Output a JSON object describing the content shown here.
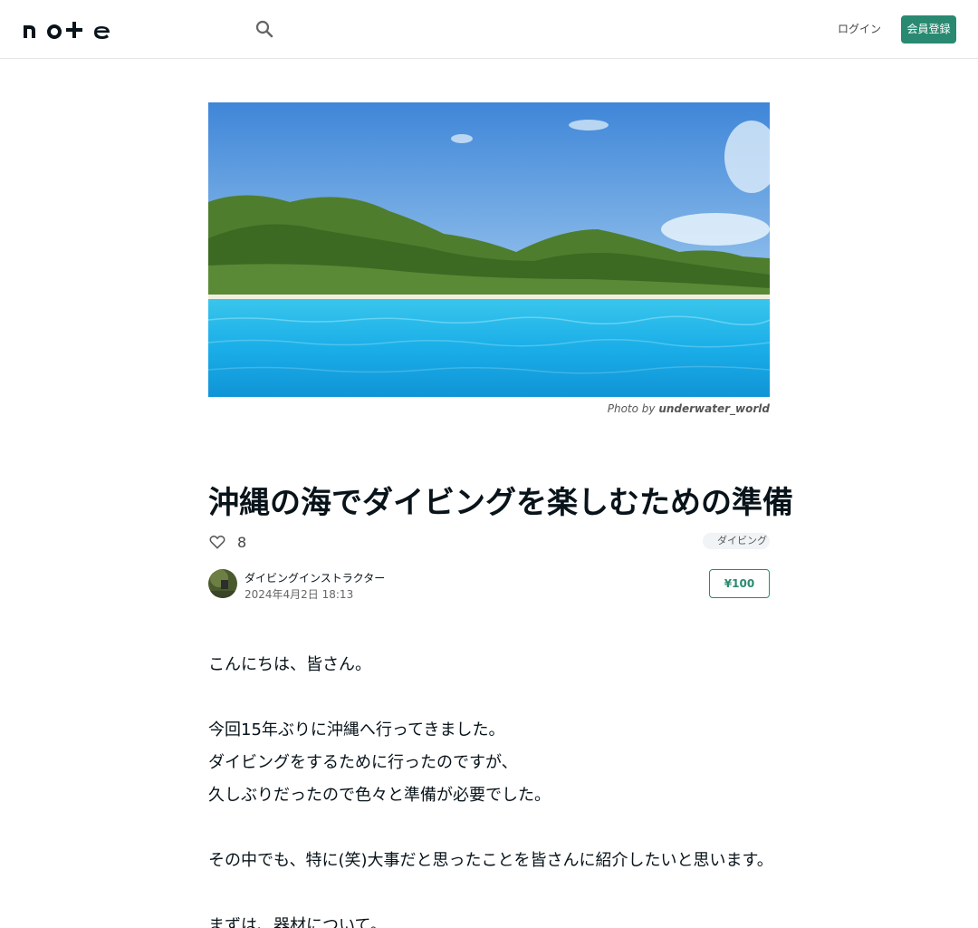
{
  "header": {
    "logo_text": "note",
    "search_icon": "search-icon",
    "login_label": "ログイン",
    "signup_label": "会員登録",
    "accent_color": "#2a8a71"
  },
  "hero": {
    "credit_prefix": "Photo by",
    "credit_user": "underwater_world"
  },
  "article": {
    "title": "沖縄の海でダイビングを楽しむための準備",
    "like_count": "8",
    "tag": "ダイビング",
    "author": "ダイビングインストラクター",
    "date": "2024年4月2日 18:13",
    "price": "¥100"
  },
  "body": {
    "lines": [
      "こんにちは、皆さん。",
      "今回15年ぶりに沖縄へ行ってきました。",
      "ダイビングをするために行ったのですが、",
      "久しぶりだったので色々と準備が必要でした。",
      "その中でも、特に(笑)大事だと思ったことを皆さんに紹介したいと思います。",
      "まずは、器材について。"
    ]
  }
}
